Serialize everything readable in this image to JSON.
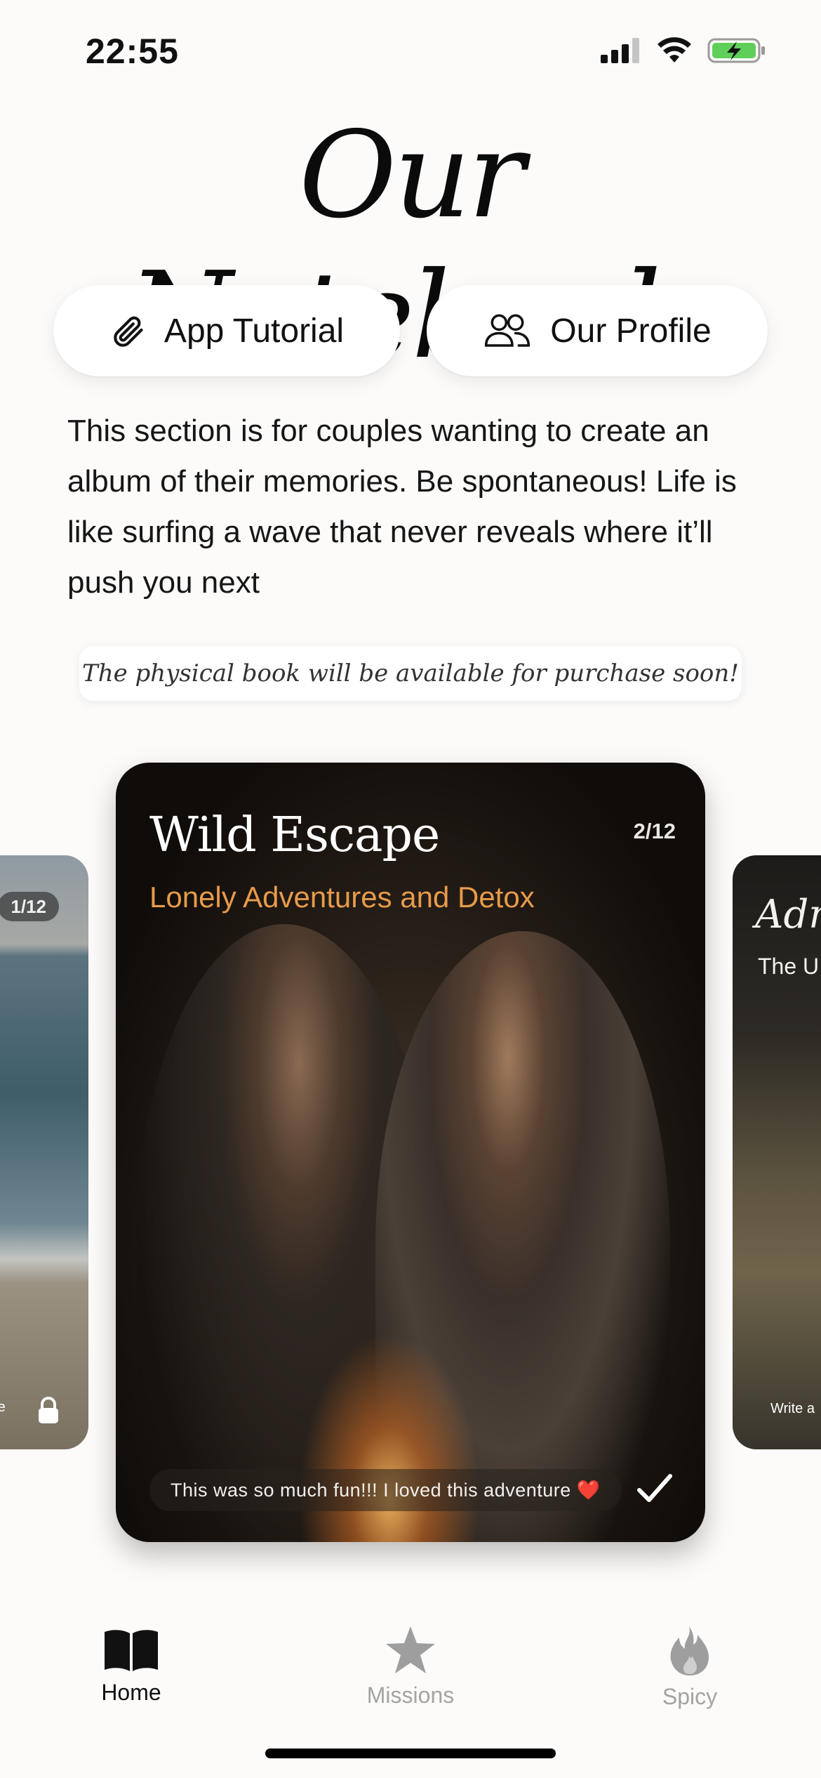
{
  "status": {
    "time": "22:55"
  },
  "header": {
    "title": "Our Notebook"
  },
  "actions": {
    "tutorial_label": "App Tutorial",
    "profile_label": "Our Profile"
  },
  "description": "This section is for couples wanting to create an album of their memories. Be spontaneous! Life is like surfing a wave that never reveals where it’ll push you next",
  "notice": "The physical book will be available for purchase soon!",
  "carousel": {
    "left_card": {
      "counter": "1/12",
      "snippet": "re"
    },
    "main_card": {
      "title": "Wild Escape",
      "counter": "2/12",
      "subtitle": "Lonely Adventures and Detox",
      "caption": "This was so much fun!!! I loved this adventure ❤️"
    },
    "right_card": {
      "title": "Adr",
      "subtitle": "The U",
      "snippet": "Write a"
    }
  },
  "tabs": [
    {
      "label": "Home",
      "icon": "book-icon",
      "active": true
    },
    {
      "label": "Missions",
      "icon": "star-icon",
      "active": false
    },
    {
      "label": "Spicy",
      "icon": "flame-icon",
      "active": false
    }
  ],
  "colors": {
    "background": "#fdfbf9",
    "accent_subtitle": "#e79b4a",
    "inactive_tab": "#a3a3a3"
  }
}
